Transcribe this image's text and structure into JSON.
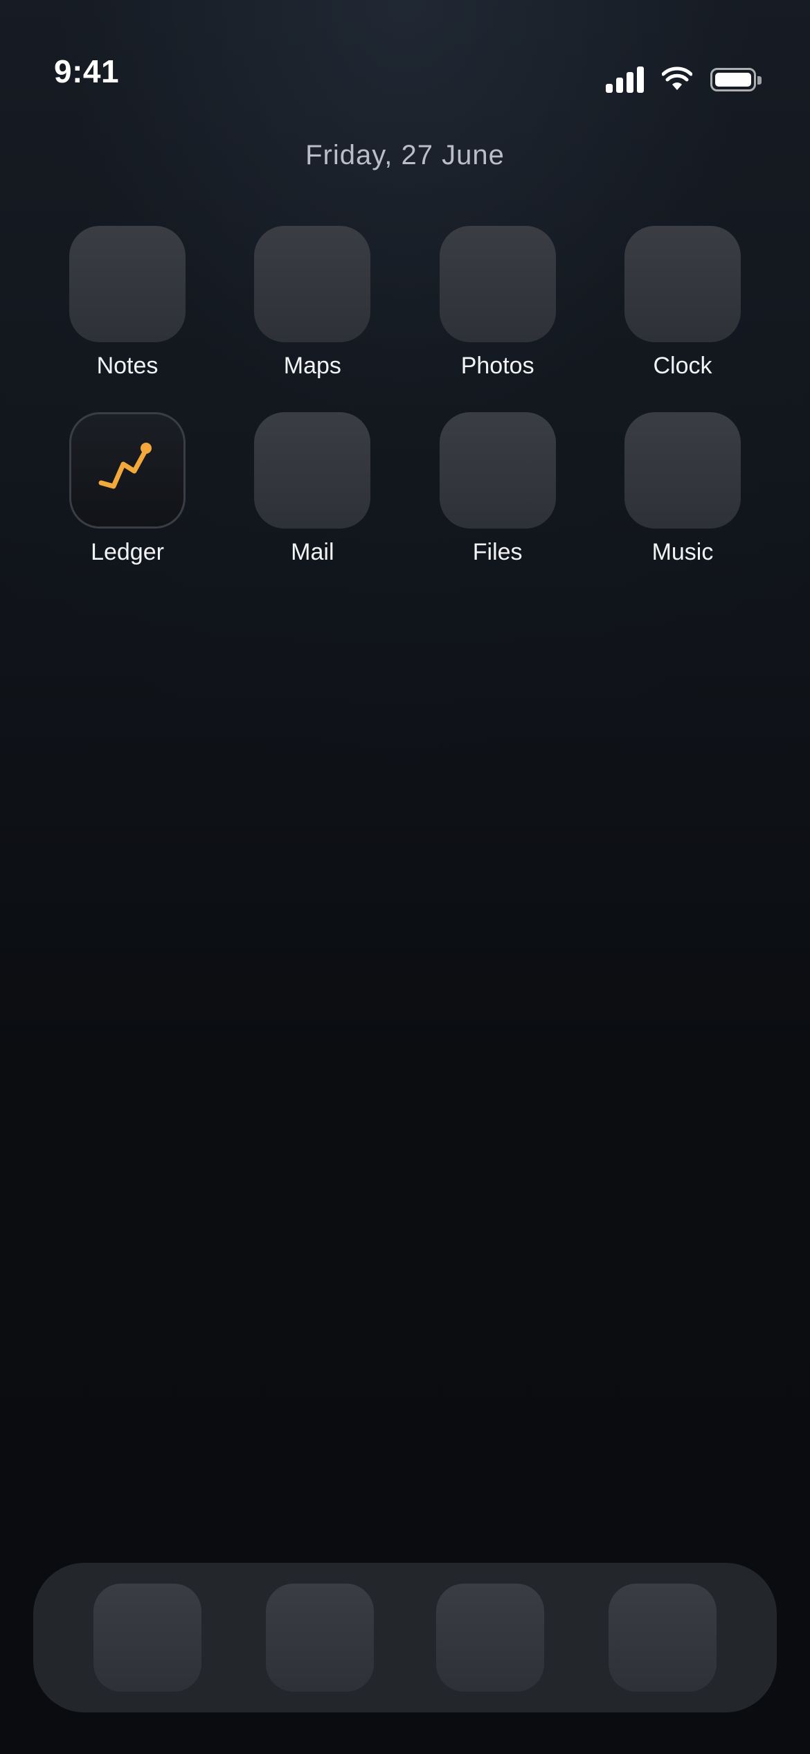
{
  "status_bar": {
    "time": "9:41",
    "icons": [
      "cellular-signal-icon",
      "wifi-icon",
      "battery-icon"
    ]
  },
  "date": "Friday, 27 June",
  "apps": [
    {
      "label": "Notes",
      "icon": "app-icon-placeholder"
    },
    {
      "label": "Maps",
      "icon": "app-icon-placeholder"
    },
    {
      "label": "Photos",
      "icon": "app-icon-placeholder"
    },
    {
      "label": "Clock",
      "icon": "app-icon-placeholder"
    },
    {
      "label": "Ledger",
      "icon": "line-chart-icon"
    },
    {
      "label": "Mail",
      "icon": "app-icon-placeholder"
    },
    {
      "label": "Files",
      "icon": "app-icon-placeholder"
    },
    {
      "label": "Music",
      "icon": "app-icon-placeholder"
    }
  ],
  "dock": {
    "icons": [
      "dock-app-icon",
      "dock-app-icon",
      "dock-app-icon",
      "dock-app-icon"
    ]
  },
  "colors": {
    "accent": "#f2a93b",
    "background_top": "#171c24",
    "background_bottom": "#0a0c10",
    "icon_tile": "#35383e",
    "dock": "#2a2c31",
    "date_text": "#b9bec7"
  }
}
